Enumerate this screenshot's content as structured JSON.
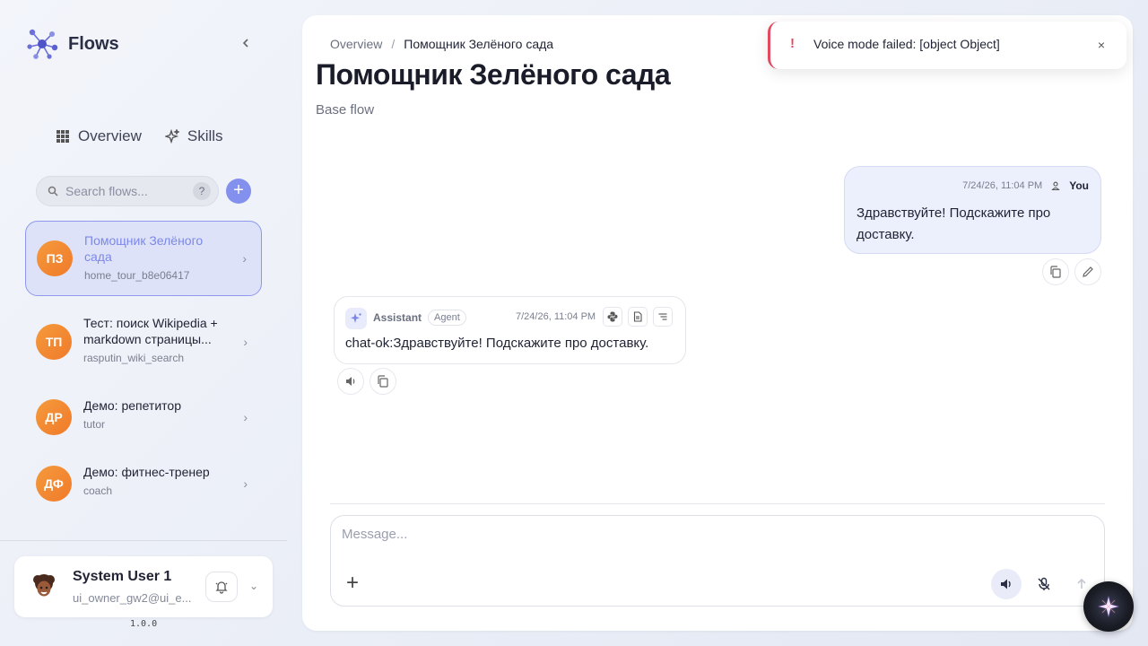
{
  "brand": {
    "name": "Flows"
  },
  "nav": {
    "overview": "Overview",
    "skills": "Skills"
  },
  "search": {
    "placeholder": "Search flows...",
    "help": "?"
  },
  "add_label": "+",
  "flows": [
    {
      "initials": "ПЗ",
      "title": "Помощник Зелёного сада",
      "slug": "home_tour_b8e06417",
      "active": true
    },
    {
      "initials": "ТП",
      "title": "Тест: поиск Wikipedia + markdown страницы...",
      "slug": "rasputin_wiki_search",
      "active": false
    },
    {
      "initials": "ДР",
      "title": "Демо: репетитор",
      "slug": "tutor",
      "active": false
    },
    {
      "initials": "ДФ",
      "title": "Демо: фитнес-тренер",
      "slug": "coach",
      "active": false
    }
  ],
  "user": {
    "name": "System User 1",
    "email": "ui_owner_gw2@ui_e..."
  },
  "version": "1.0.0",
  "breadcrumb": {
    "root": "Overview",
    "separator": "/",
    "current": "Помощник Зелёного сада"
  },
  "page": {
    "title": "Помощник Зелёного сада",
    "subtitle": "Base flow"
  },
  "messages": {
    "user": {
      "time": "7/24/26, 11:04 PM",
      "author": "You",
      "text": "Здравствуйте! Подскажите про доставку."
    },
    "assistant": {
      "author": "Assistant",
      "tag": "Agent",
      "time": "7/24/26, 11:04 PM",
      "text": "chat-ok:Здравствуйте! Подскажите про доставку."
    }
  },
  "composer": {
    "placeholder": "Message...",
    "plus": "+"
  },
  "toast": {
    "icon": "!",
    "text": "Voice mode failed: [object Object]",
    "close": "×"
  },
  "colors": {
    "accent": "#8490ee",
    "avatar": "#f59a3c",
    "error": "#e24a62"
  }
}
